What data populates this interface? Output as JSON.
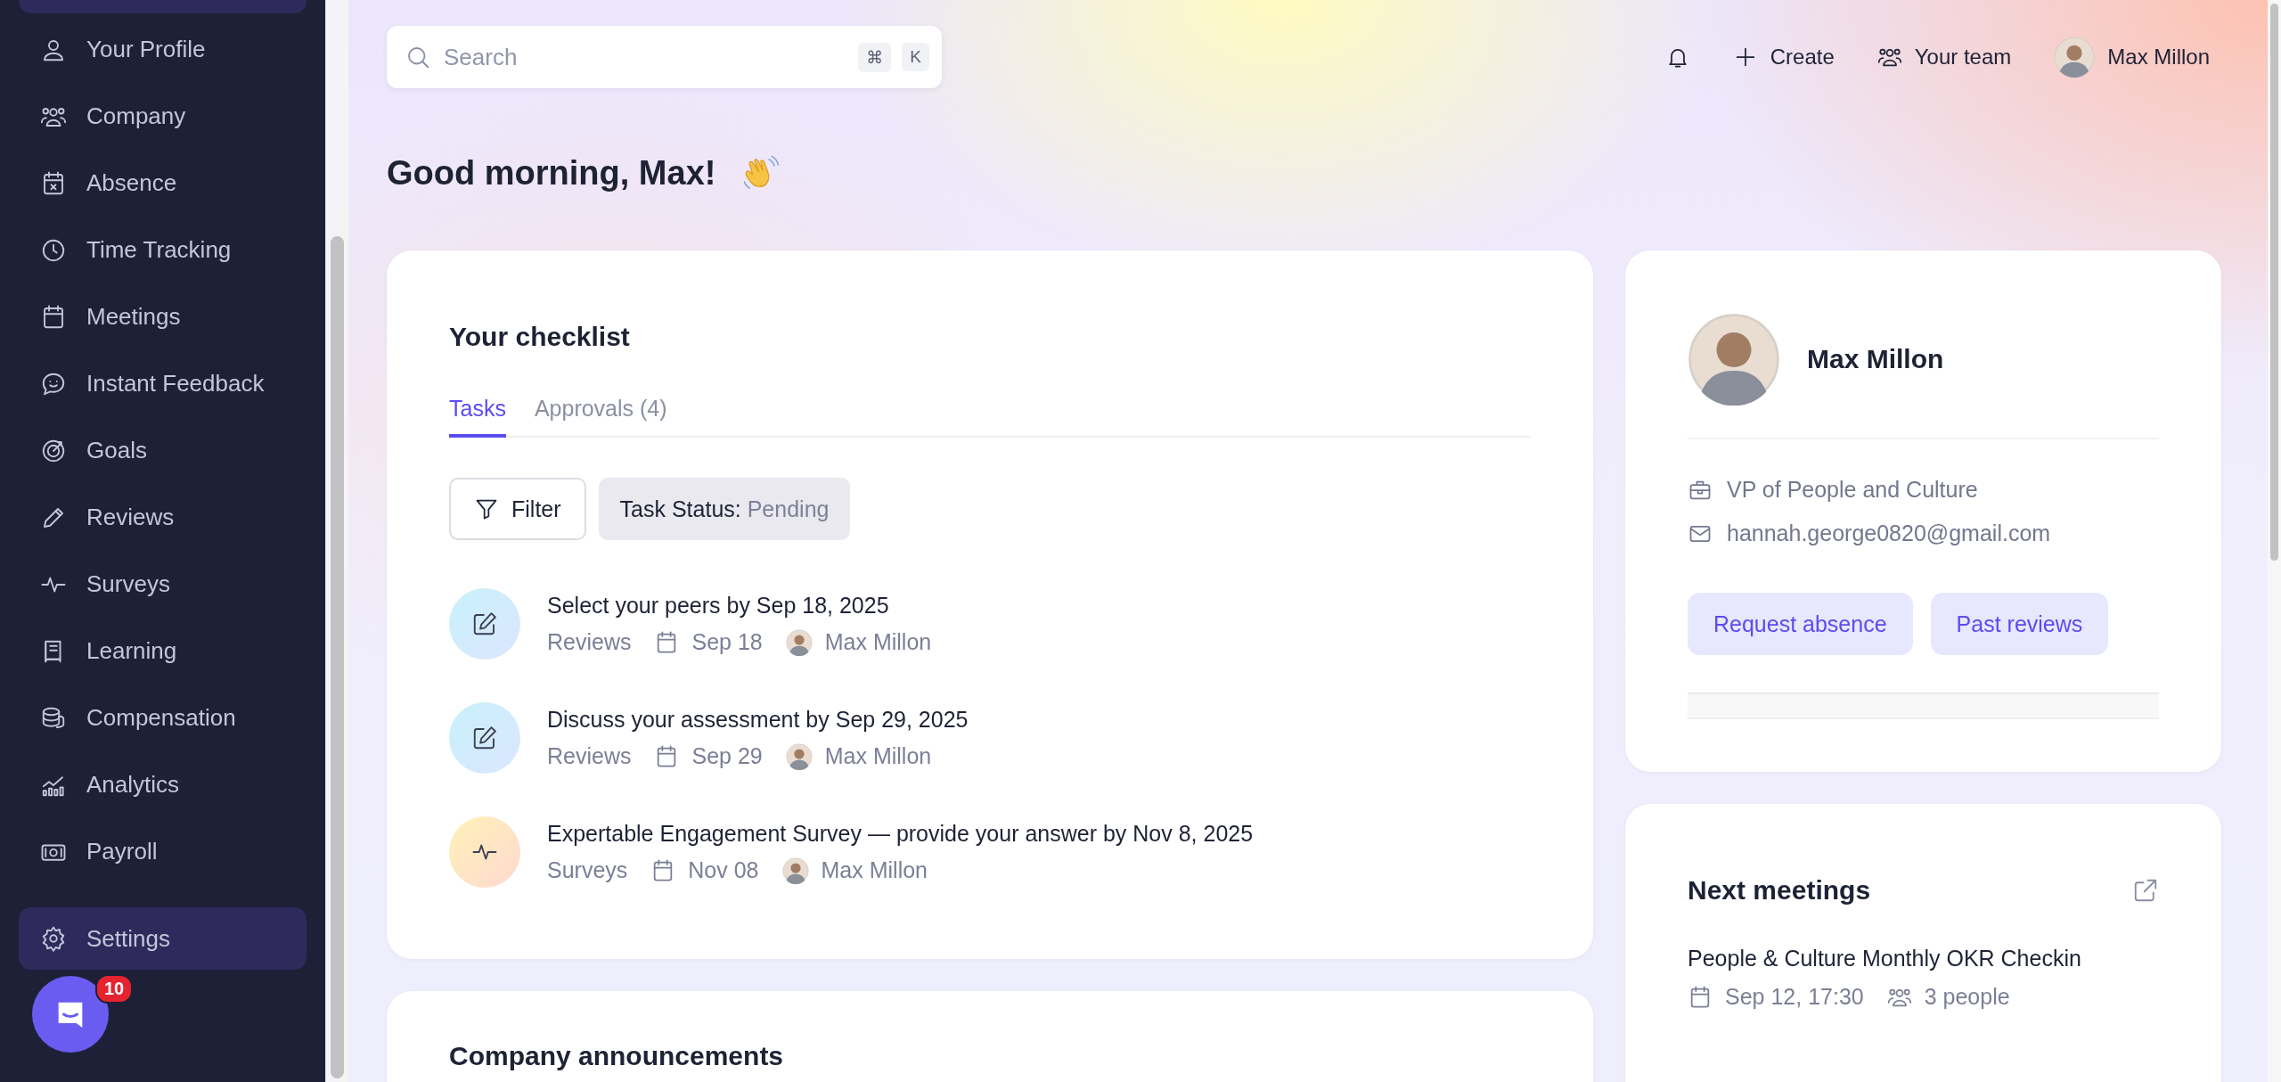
{
  "sidebar": {
    "items": [
      {
        "label": "Your Profile",
        "selected": false
      },
      {
        "label": "Company",
        "selected": false
      },
      {
        "label": "Absence",
        "selected": false
      },
      {
        "label": "Time Tracking",
        "selected": false
      },
      {
        "label": "Meetings",
        "selected": false
      },
      {
        "label": "Instant Feedback",
        "selected": false
      },
      {
        "label": "Goals",
        "selected": false
      },
      {
        "label": "Reviews",
        "selected": false
      },
      {
        "label": "Surveys",
        "selected": false
      },
      {
        "label": "Learning",
        "selected": false
      },
      {
        "label": "Compensation",
        "selected": false
      },
      {
        "label": "Analytics",
        "selected": false
      },
      {
        "label": "Payroll",
        "selected": false
      }
    ],
    "footer_item": {
      "label": "Settings",
      "selected": true
    },
    "chat_badge": "10"
  },
  "search": {
    "placeholder": "Search",
    "shortcut": [
      "⌘",
      "K"
    ]
  },
  "topbar": {
    "create": "Create",
    "team": "Your team",
    "user": "Max Millon"
  },
  "greeting": "Good morning, Max!",
  "checklist": {
    "title": "Your checklist",
    "tabs": [
      {
        "label": "Tasks",
        "selected": true
      },
      {
        "label": "Approvals (4)",
        "selected": false
      }
    ],
    "filter": "Filter",
    "status_label": "Task Status:",
    "status_value": "Pending",
    "tasks": [
      {
        "kind": "review",
        "title": "Select your peers by Sep 18, 2025",
        "category": "Reviews",
        "date": "Sep 18",
        "assignee": "Max Millon"
      },
      {
        "kind": "review",
        "title": "Discuss your assessment by Sep 29, 2025",
        "category": "Reviews",
        "date": "Sep 29",
        "assignee": "Max Millon"
      },
      {
        "kind": "survey",
        "title": "Expertable Engagement Survey — provide your answer by Nov 8, 2025",
        "category": "Surveys",
        "date": "Nov 08",
        "assignee": "Max Millon"
      }
    ]
  },
  "announcements": {
    "title": "Company announcements"
  },
  "profile": {
    "name": "Max Millon",
    "job": "VP of People and Culture",
    "email": "hannah.george0820@gmail.com",
    "buttons": [
      "Request absence",
      "Past reviews"
    ]
  },
  "meetings": {
    "title": "Next meetings",
    "items": [
      {
        "title": "People & Culture Monthly OKR Checkin",
        "when": "Sep 12, 17:30",
        "people": "3 people"
      }
    ]
  }
}
